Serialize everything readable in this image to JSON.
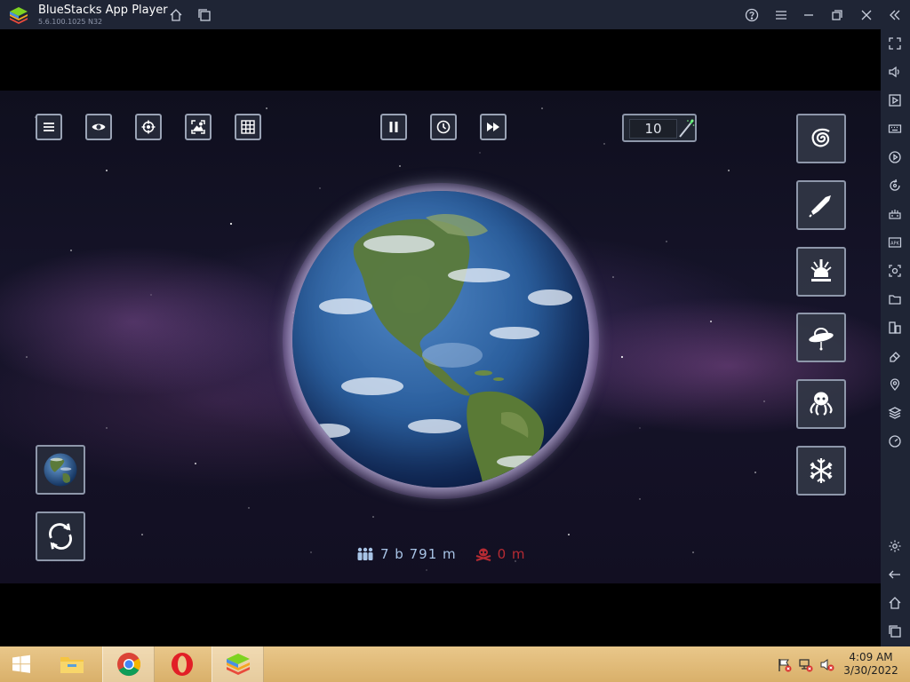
{
  "window": {
    "title": "BlueStacks App Player",
    "version": "5.6.100.1025 N32"
  },
  "titlebar_icons": [
    "home-icon",
    "multi-instance-icon",
    "help-icon",
    "menu-icon",
    "minimize-icon",
    "maximize-icon",
    "close-icon",
    "collapse-sidebar-icon"
  ],
  "sidebar_icons": [
    "fullscreen-icon",
    "volume-icon",
    "media-icon",
    "keyboard-icon",
    "macro-play-icon",
    "rotate-icon",
    "controls-icon",
    "apk-icon",
    "screenshot-icon",
    "folder-icon",
    "multi-instance-icon",
    "erase-icon",
    "location-icon",
    "layers-icon",
    "performance-icon",
    "settings-icon",
    "back-icon",
    "home-icon",
    "recent-apps-icon"
  ],
  "game": {
    "counter_value": "10",
    "population": "7 b 791 m",
    "deaths": "0 m",
    "colors": {
      "population": "#a8c4e6",
      "deaths": "#b62b33"
    }
  },
  "taskbar": {
    "time": "4:09 AM",
    "date": "3/30/2022"
  }
}
